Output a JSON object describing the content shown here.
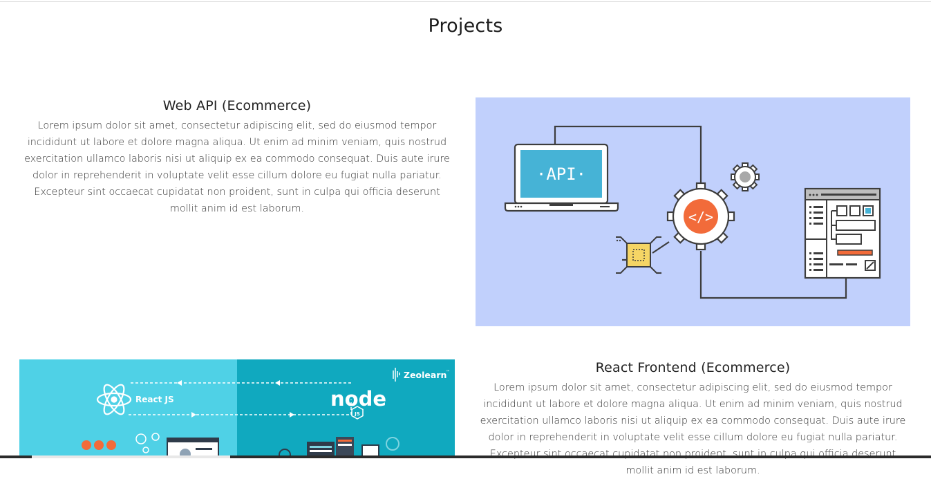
{
  "section": {
    "title": "Projects"
  },
  "projects": [
    {
      "title": "Web API (Ecommerce)",
      "description": "Lorem ipsum dolor sit amet, consectetur adipiscing elit, sed do eiusmod tempor incididunt ut labore et dolore magna aliqua. Ut enim ad minim veniam, quis nostrud exercitation ullamco laboris nisi ut aliquip ex ea commodo consequat. Duis aute irure dolor in reprehenderit in voluptate velit esse cillum dolore eu fugiat nulla pariatur. Excepteur sint occaecat cupidatat non proident, sunt in culpa qui officia deserunt mollit anim id est laborum.",
      "image": {
        "screen_text": "·API·",
        "code_glyph": "</>"
      }
    },
    {
      "title": "React Frontend (Ecommerce)",
      "description": "Lorem ipsum dolor sit amet, consectetur adipiscing elit, sed do eiusmod tempor incididunt ut labore et dolore magna aliqua. Ut enim ad minim veniam, quis nostrud exercitation ullamco laboris nisi ut aliquip ex ea commodo consequat. Duis aute irure dolor in reprehenderit in voluptate velit esse cillum dolore eu fugiat nulla pariatur. Excepteur sint occaecat cupidatat non proident, sunt in culpa qui officia deserunt mollit anim id est laborum.",
      "image": {
        "left_label": "React JS",
        "right_label": "node",
        "badge": "JS",
        "brand": "Zeolearn",
        "brand_mark": "™"
      }
    }
  ],
  "colors": {
    "api_bg": "#c1d0fc",
    "react_left": "#4fd1e6",
    "react_right": "#10a9bf",
    "accent_orange": "#f26b3a",
    "chip_yellow": "#f5d565",
    "screen_blue": "#46b3d6"
  }
}
